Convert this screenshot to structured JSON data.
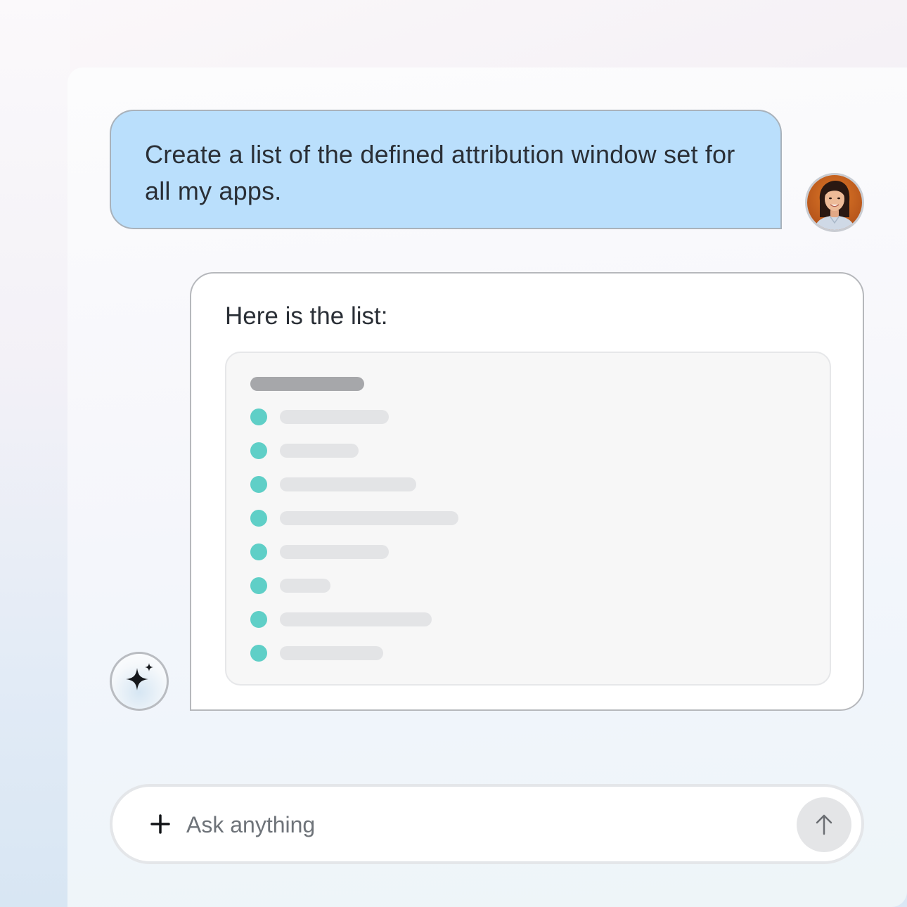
{
  "user_message": {
    "text": "Create a list of the defined attribution window set for all my apps."
  },
  "user_avatar": {
    "icon": "user-portrait"
  },
  "assistant_message": {
    "text": "Here is the list:",
    "list_placeholder": {
      "item_count": 8,
      "bullet_color": "#5fcfc7",
      "line_color": "#e3e4e6",
      "title_bar_color": "#a6a7aa",
      "item_lengths": [
        0.18,
        0.13,
        0.225,
        0.295,
        0.18,
        0.083,
        0.25,
        0.17
      ]
    }
  },
  "assistant_avatar": {
    "icon": "sparkle-icon"
  },
  "composer": {
    "placeholder": "Ask anything",
    "value": "",
    "attach_icon": "plus-icon",
    "send_icon": "arrow-up-icon"
  },
  "colors": {
    "user_bubble": "#badffc",
    "assistant_bubble": "#ffffff",
    "accent_bullet": "#5fcfc7"
  }
}
